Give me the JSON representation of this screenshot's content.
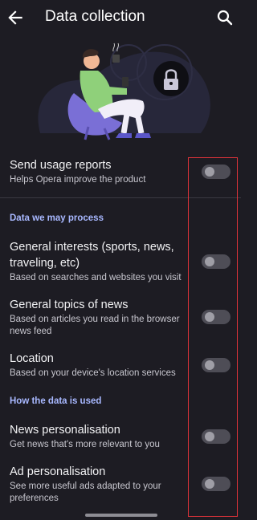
{
  "appbar": {
    "title": "Data collection",
    "back_icon": "arrow-left-icon",
    "search_icon": "search-icon"
  },
  "illustration": {
    "icon": "lock-icon"
  },
  "settings": {
    "send_usage": {
      "label": "Send usage reports",
      "sub": "Helps Opera improve the product",
      "on": false
    },
    "section_process": "Data we may process",
    "general_interests": {
      "label_line1": "General interests (sports, news,",
      "label_line2": "traveling, etc)",
      "sub": "Based on searches and websites you visit",
      "on": false
    },
    "general_topics": {
      "label": "General topics of news",
      "sub_line1": "Based on articles you read in the browser",
      "sub_line2": "news feed",
      "on": false
    },
    "location": {
      "label": "Location",
      "sub": "Based on your device's location services",
      "on": false
    },
    "section_used": "How the data is used",
    "news_personalisation": {
      "label": "News personalisation",
      "sub": "Get news that's more relevant to you",
      "on": false
    },
    "ad_personalisation": {
      "label": "Ad personalisation",
      "sub_line1": "See more useful ads adapted to your",
      "sub_line2": "preferences",
      "on": false
    }
  },
  "colors": {
    "background": "#1d1c23",
    "section": "#a8b8ff",
    "highlight": "#e0333a"
  }
}
